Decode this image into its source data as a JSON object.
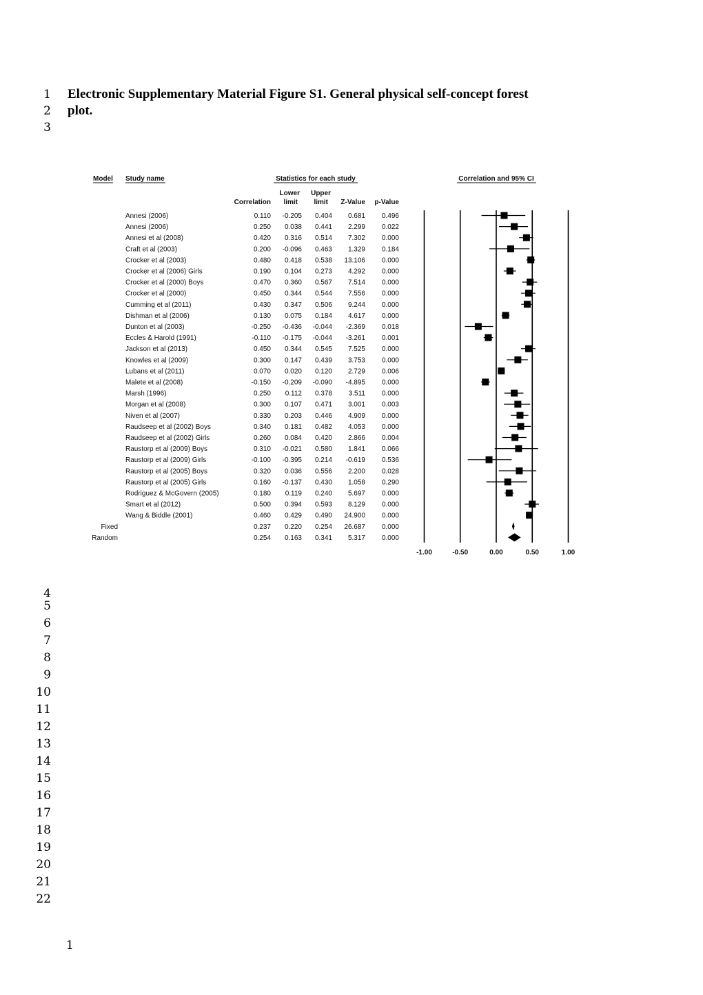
{
  "document": {
    "title_line1": "Electronic Supplementary Material Figure S1. General physical self-concept forest",
    "title_line2": "plot.",
    "line_numbers": [
      "1",
      "2",
      "3",
      "4",
      "5",
      "6",
      "7",
      "8",
      "9",
      "10",
      "11",
      "12",
      "13",
      "14",
      "15",
      "16",
      "17",
      "18",
      "19",
      "20",
      "21",
      "22"
    ],
    "page_number": "1"
  },
  "chart_data": {
    "type": "table",
    "subtype": "forest-plot",
    "headers": {
      "model": "Model",
      "study_name": "Study name",
      "stats_group": "Statistics for each study",
      "correlation": "Correlation",
      "lower_limit": [
        "Lower",
        "limit"
      ],
      "upper_limit": [
        "Upper",
        "limit"
      ],
      "z_value": "Z-Value",
      "p_value": "p-Value",
      "plot_title": "Correlation and 95% CI"
    },
    "studies": [
      {
        "name": "Annesi (2006)",
        "r": "0.110",
        "lower": "-0.205",
        "upper": "0.404",
        "z": "0.681",
        "p": "0.496"
      },
      {
        "name": "Annesi (2006)",
        "r": "0.250",
        "lower": "0.038",
        "upper": "0.441",
        "z": "2.299",
        "p": "0.022"
      },
      {
        "name": "Annesi et al (2008)",
        "r": "0.420",
        "lower": "0.316",
        "upper": "0.514",
        "z": "7.302",
        "p": "0.000"
      },
      {
        "name": "Craft et al (2003)",
        "r": "0.200",
        "lower": "-0.096",
        "upper": "0.463",
        "z": "1.329",
        "p": "0.184"
      },
      {
        "name": "Crocker et al (2003)",
        "r": "0.480",
        "lower": "0.418",
        "upper": "0.538",
        "z": "13.106",
        "p": "0.000"
      },
      {
        "name": "Crocker et al (2006) Girls",
        "r": "0.190",
        "lower": "0.104",
        "upper": "0.273",
        "z": "4.292",
        "p": "0.000"
      },
      {
        "name": "Crocker et al (2000) Boys",
        "r": "0.470",
        "lower": "0.360",
        "upper": "0.567",
        "z": "7.514",
        "p": "0.000"
      },
      {
        "name": "Crocker et al (2000)",
        "r": "0.450",
        "lower": "0.344",
        "upper": "0.544",
        "z": "7.556",
        "p": "0.000"
      },
      {
        "name": "Cumming et al (2011)",
        "r": "0.430",
        "lower": "0.347",
        "upper": "0.506",
        "z": "9.244",
        "p": "0.000"
      },
      {
        "name": "Dishman et al (2006)",
        "r": "0.130",
        "lower": "0.075",
        "upper": "0.184",
        "z": "4.617",
        "p": "0.000"
      },
      {
        "name": "Dunton et al (2003)",
        "r": "-0.250",
        "lower": "-0.436",
        "upper": "-0.044",
        "z": "-2.369",
        "p": "0.018"
      },
      {
        "name": "Eccles & Harold (1991)",
        "r": "-0.110",
        "lower": "-0.175",
        "upper": "-0.044",
        "z": "-3.261",
        "p": "0.001"
      },
      {
        "name": "Jackson et al (2013)",
        "r": "0.450",
        "lower": "0.344",
        "upper": "0.545",
        "z": "7.525",
        "p": "0.000"
      },
      {
        "name": "Knowles et al (2009)",
        "r": "0.300",
        "lower": "0.147",
        "upper": "0.439",
        "z": "3.753",
        "p": "0.000"
      },
      {
        "name": "Lubans et al (2011)",
        "r": "0.070",
        "lower": "0.020",
        "upper": "0.120",
        "z": "2.729",
        "p": "0.006"
      },
      {
        "name": "Malete et al (2008)",
        "r": "-0.150",
        "lower": "-0.209",
        "upper": "-0.090",
        "z": "-4.895",
        "p": "0.000"
      },
      {
        "name": "Marsh (1996)",
        "r": "0.250",
        "lower": "0.112",
        "upper": "0.378",
        "z": "3.511",
        "p": "0.000"
      },
      {
        "name": "Morgan et al (2008)",
        "r": "0.300",
        "lower": "0.107",
        "upper": "0.471",
        "z": "3.001",
        "p": "0.003"
      },
      {
        "name": "Niven et al (2007)",
        "r": "0.330",
        "lower": "0.203",
        "upper": "0.446",
        "z": "4.909",
        "p": "0.000"
      },
      {
        "name": "Raudseep et al (2002) Boys",
        "r": "0.340",
        "lower": "0.181",
        "upper": "0.482",
        "z": "4.053",
        "p": "0.000"
      },
      {
        "name": "Raudseep et al (2002) Girls",
        "r": "0.260",
        "lower": "0.084",
        "upper": "0.420",
        "z": "2.866",
        "p": "0.004"
      },
      {
        "name": "Raustorp et al (2009) Boys",
        "r": "0.310",
        "lower": "-0.021",
        "upper": "0.580",
        "z": "1.841",
        "p": "0.066"
      },
      {
        "name": "Raustorp et al (2009) Girls",
        "r": "-0.100",
        "lower": "-0.395",
        "upper": "0.214",
        "z": "-0.619",
        "p": "0.536"
      },
      {
        "name": "Raustorp et al (2005)  Boys",
        "r": "0.320",
        "lower": "0.036",
        "upper": "0.556",
        "z": "2.200",
        "p": "0.028"
      },
      {
        "name": "Raustorp et al (2005) Girls",
        "r": "0.160",
        "lower": "-0.137",
        "upper": "0.430",
        "z": "1.058",
        "p": "0.290"
      },
      {
        "name": "Rodriguez & McGovern (2005)",
        "r": "0.180",
        "lower": "0.119",
        "upper": "0.240",
        "z": "5.697",
        "p": "0.000"
      },
      {
        "name": "Smart et al (2012)",
        "r": "0.500",
        "lower": "0.394",
        "upper": "0.593",
        "z": "8.129",
        "p": "0.000"
      },
      {
        "name": "Wang & Biddle (2001)",
        "r": "0.460",
        "lower": "0.429",
        "upper": "0.490",
        "z": "24.900",
        "p": "0.000"
      }
    ],
    "summaries": [
      {
        "model": "Fixed",
        "r": "0.237",
        "lower": "0.220",
        "upper": "0.254",
        "z": "26.687",
        "p": "0.000"
      },
      {
        "model": "Random",
        "r": "0.254",
        "lower": "0.163",
        "upper": "0.341",
        "z": "5.317",
        "p": "0.000"
      }
    ],
    "x_axis": {
      "ticks": [
        "-1.00",
        "-0.50",
        "0.00",
        "0.50",
        "1.00"
      ],
      "tick_values": [
        -1,
        -0.5,
        0,
        0.5,
        1
      ],
      "range": [
        -1,
        1
      ]
    },
    "reference_lines": [
      -1,
      -0.5,
      0,
      0.5,
      1
    ]
  }
}
